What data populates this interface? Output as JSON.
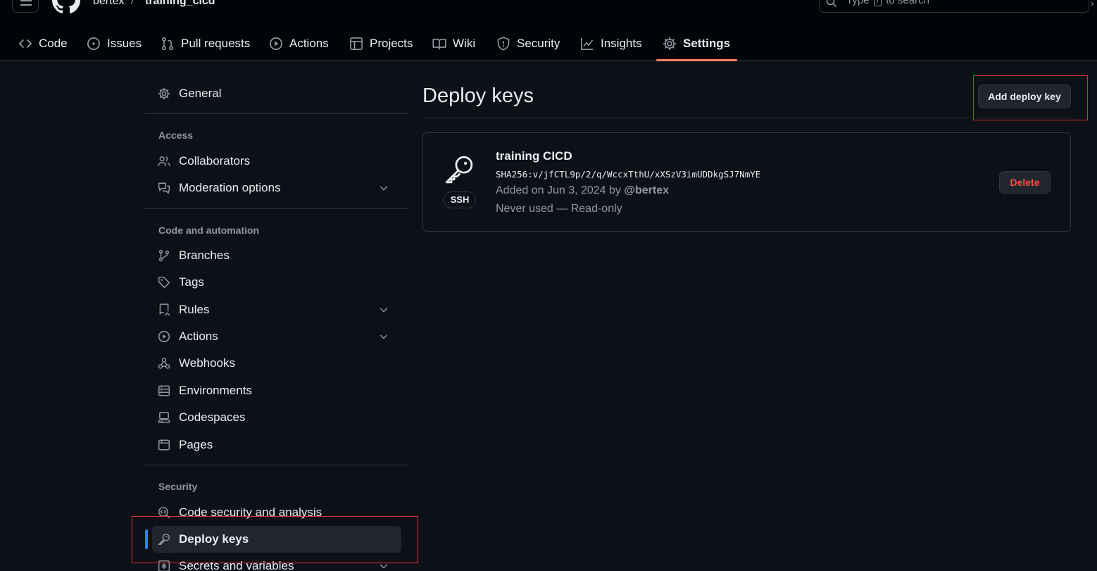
{
  "repo": {
    "owner": "bertex",
    "separator": "/",
    "name": "training_cicd"
  },
  "search": {
    "prefix": "Type",
    "key": "/",
    "suffix": "to search"
  },
  "tabs": [
    {
      "label": "Code",
      "icon": "code-icon"
    },
    {
      "label": "Issues",
      "icon": "issue-opened-icon"
    },
    {
      "label": "Pull requests",
      "icon": "git-pull-request-icon"
    },
    {
      "label": "Actions",
      "icon": "play-icon"
    },
    {
      "label": "Projects",
      "icon": "table-icon"
    },
    {
      "label": "Wiki",
      "icon": "book-icon"
    },
    {
      "label": "Security",
      "icon": "shield-icon"
    },
    {
      "label": "Insights",
      "icon": "graph-icon"
    },
    {
      "label": "Settings",
      "icon": "gear-icon",
      "selected": true
    }
  ],
  "sidebar": {
    "general": "General",
    "sections": {
      "access": "Access",
      "code_automation": "Code and automation",
      "security": "Security"
    },
    "items": {
      "collaborators": "Collaborators",
      "moderation": "Moderation options",
      "branches": "Branches",
      "tags": "Tags",
      "rules": "Rules",
      "actions": "Actions",
      "webhooks": "Webhooks",
      "environments": "Environments",
      "codespaces": "Codespaces",
      "pages": "Pages",
      "code_security": "Code security and analysis",
      "deploy_keys": "Deploy keys",
      "secrets": "Secrets and variables"
    },
    "active_item": "Deploy keys"
  },
  "main": {
    "title": "Deploy keys",
    "add_button": "Add deploy key",
    "keys": [
      {
        "title": "training CICD",
        "fingerprint": "SHA256:v/jfCTL9p/2/q/WccxTthU/xXSzV3imUDDkgSJ7NmYE",
        "added_prefix": "Added on Jun 3, 2024 by",
        "added_by": "@bertex",
        "usage": "Never used — Read-only",
        "type_badge": "SSH",
        "delete_label": "Delete"
      }
    ]
  },
  "colors": {
    "background": "#0d1117",
    "header": "#010409",
    "selected_tab_underline": "#f78166",
    "active_nav_indicator": "#2f81f7",
    "danger": "#f85149",
    "highlight_box": "#e03131"
  }
}
